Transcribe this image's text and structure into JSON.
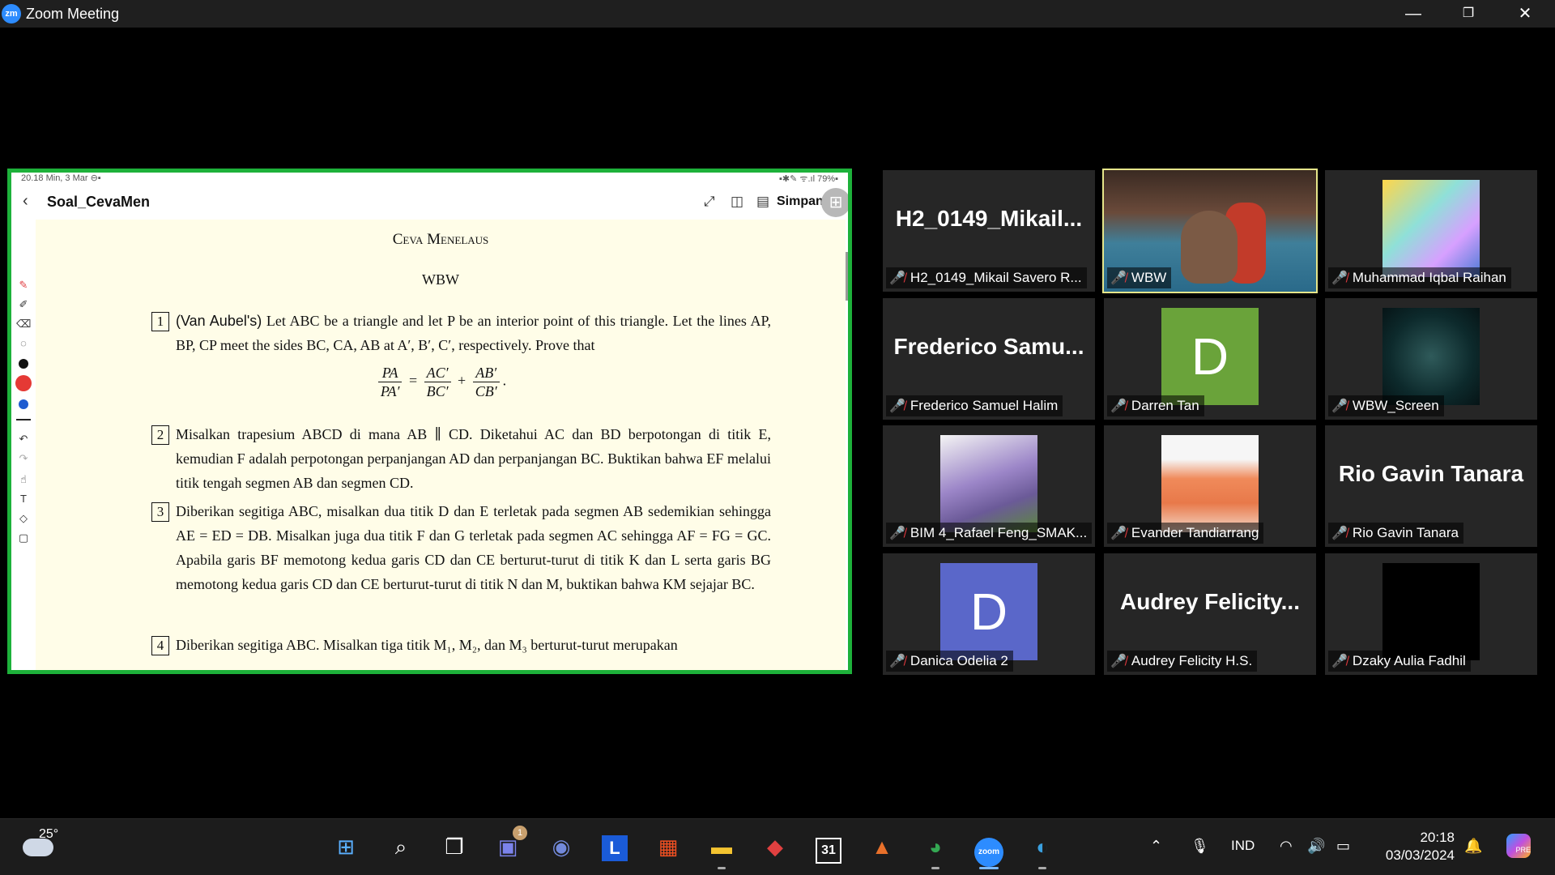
{
  "window": {
    "title": "Zoom Meeting",
    "logo_text": "zm",
    "minimize": "—",
    "restore": "❐",
    "close": "✕"
  },
  "share": {
    "status_left": "20.18  Min, 3 Mar  ⊖▪",
    "status_right": "▪✱✎ ᯤ.ıl 79%▪",
    "doc_title": "Soal_CevaMen",
    "save_label": "Simpan",
    "paper": {
      "title": "Ceva Menelaus",
      "author": "WBW",
      "problems": [
        {
          "num": "1",
          "lead": "(Van Aubel's)",
          "text": " Let ABC be a triangle and let P be an interior point of this triangle. Let the lines AP, BP, CP meet the sides BC, CA, AB at A′, B′, C′, respectively. Prove that"
        },
        {
          "num": "2",
          "text": "Misalkan trapesium ABCD di mana AB ∥ CD. Diketahui AC dan BD berpotongan di titik E, kemudian F adalah perpotongan perpanjangan AD dan perpanjangan BC. Buktikan bahwa EF melalui titik tengah segmen AB dan segmen CD."
        },
        {
          "num": "3",
          "text": "Diberikan segitiga ABC, misalkan dua titik D dan E terletak pada segmen AB sedemikian sehingga AE = ED = DB. Misalkan juga dua titik F dan G terletak pada segmen AC sehingga AF = FG = GC. Apabila garis BF memotong kedua garis CD dan CE berturut-turut di titik K dan L serta garis BG memotong kedua garis CD dan CE berturut-turut di titik N dan M, buktikan bahwa KM sejajar BC."
        },
        {
          "num": "4",
          "text": "Diberikan segitiga ABC. Misalkan tiga titik M₁, M₂, dan M₃ berturut-turut merupakan"
        }
      ],
      "formula": {
        "l_num": "PA",
        "l_den": "PA′",
        "eq": "=",
        "a_num": "AC′",
        "a_den": "BC′",
        "plus": "+",
        "b_num": "AB′",
        "b_den": "CB′",
        "end": "."
      }
    }
  },
  "participants": [
    {
      "name": "H2_0149_Mikail Savero R...",
      "display": "H2_0149_Mikail...",
      "kind": "name"
    },
    {
      "name": "WBW",
      "kind": "video",
      "active": true
    },
    {
      "name": "Muhammad Iqbal Raihan",
      "kind": "image"
    },
    {
      "name": "Frederico Samuel Halim",
      "display": "Frederico  Samu...",
      "kind": "name"
    },
    {
      "name": "Darren Tan",
      "avatar": "D",
      "avatar_color": "#6aa33a",
      "kind": "avatar"
    },
    {
      "name": "WBW_Screen",
      "kind": "image"
    },
    {
      "name": "BIM 4_Rafael Feng_SMAK...",
      "kind": "image"
    },
    {
      "name": "Evander Tandiarrang",
      "kind": "image"
    },
    {
      "name": "Rio Gavin Tanara",
      "display": "Rio Gavin Tanara",
      "kind": "name"
    },
    {
      "name": "Danica Odelia 2",
      "avatar": "D",
      "avatar_color": "#5a67c9",
      "kind": "avatar"
    },
    {
      "name": "Audrey Felicity H.S.",
      "display": "Audrey  Felicity...",
      "kind": "name"
    },
    {
      "name": "Dzaky Aulia Fadhil",
      "kind": "image"
    }
  ],
  "taskbar": {
    "weather_temp": "25°",
    "teams_badge": "1",
    "launcher_letter": "L",
    "calendar_day": "31",
    "zoom_label": "zoom",
    "language": "IND",
    "time": "20:18",
    "date": "03/03/2024",
    "copilot_badge": "PRE"
  },
  "colors": {
    "share_border": "#1db13a",
    "active_speaker": "#e6e68a",
    "muted_icon": "#e0393e"
  }
}
